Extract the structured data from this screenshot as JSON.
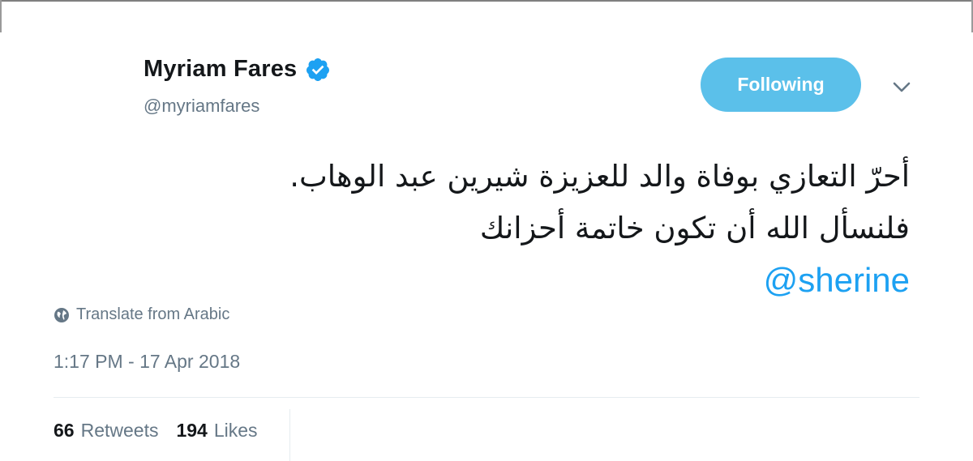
{
  "author": {
    "name": "Myriam Fares",
    "handle": "@myriamfares",
    "verified": true
  },
  "follow_button": {
    "label": "Following"
  },
  "tweet": {
    "lines": [
      "أحرّ التعازي بوفاة والد للعزيزة شيرين عبد الوهاب.",
      "فلنسأل الله أن تكون خاتمة أحزانك"
    ],
    "mention": "@sherine"
  },
  "translate": {
    "label": "Translate from Arabic",
    "icon": "globe-icon"
  },
  "timestamp": "1:17 PM - 17 Apr 2018",
  "stats": {
    "retweets": {
      "count": "66",
      "label": "Retweets"
    },
    "likes": {
      "count": "194",
      "label": "Likes"
    }
  },
  "colors": {
    "accent": "#1da1f2",
    "button": "#5bc0ea",
    "secondary_text": "#657786",
    "primary_text": "#14171a"
  }
}
